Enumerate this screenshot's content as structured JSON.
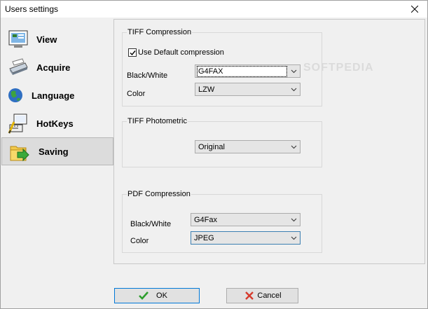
{
  "window": {
    "title": "Users settings"
  },
  "nav": {
    "items": [
      {
        "label": "View",
        "icon": "view-icon"
      },
      {
        "label": "Acquire",
        "icon": "scanner-icon"
      },
      {
        "label": "Language",
        "icon": "globe-icon"
      },
      {
        "label": "HotKeys",
        "icon": "hotkeys-icon"
      },
      {
        "label": "Saving",
        "icon": "saving-icon",
        "active": true
      }
    ]
  },
  "tiff_compression": {
    "title": "TIFF Compression",
    "use_default_label": "Use Default compression",
    "use_default_checked": true,
    "bw_label": "Black/White",
    "bw_value": "G4FAX",
    "color_label": "Color",
    "color_value": "LZW"
  },
  "tiff_photometric": {
    "title": "TIFF Photometric",
    "value": "Original"
  },
  "pdf_compression": {
    "title": "PDF Compression",
    "bw_label": "Black/White",
    "bw_value": "G4Fax",
    "color_label": "Color",
    "color_value": "JPEG"
  },
  "buttons": {
    "ok": "OK",
    "cancel": "Cancel"
  },
  "watermark": "SOFTPEDIA",
  "colors": {
    "accent": "#0078d7",
    "ok_check": "#2e9e2e",
    "cancel_x": "#d63b2e"
  }
}
